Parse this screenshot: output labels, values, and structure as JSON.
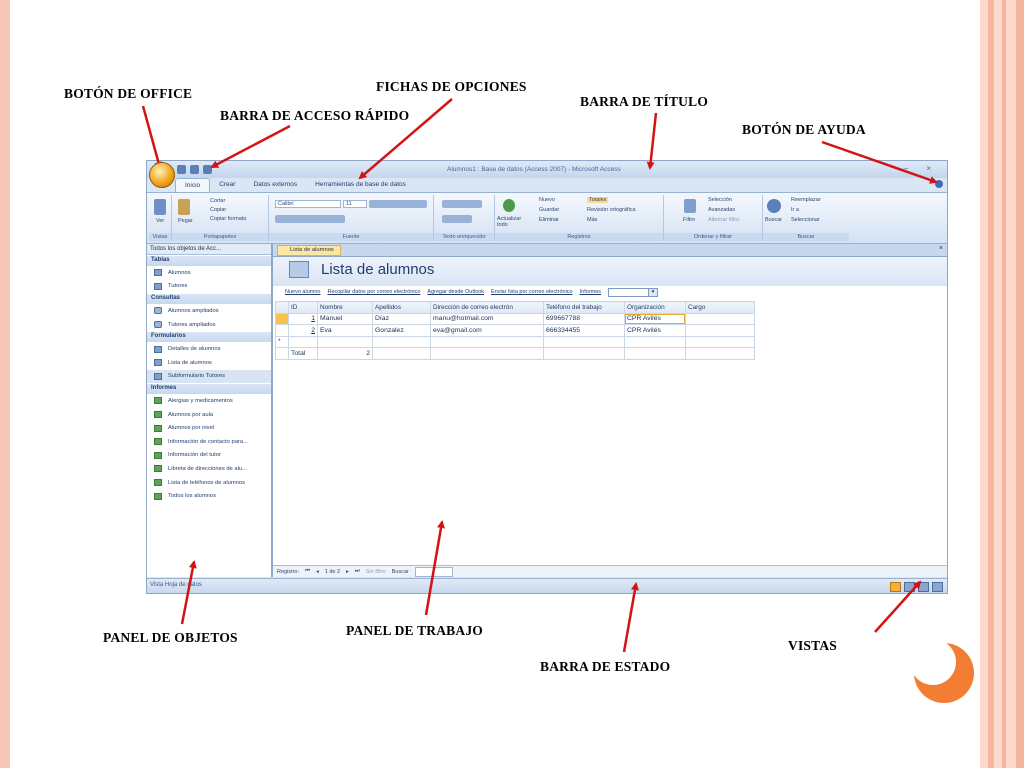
{
  "slide": {
    "colors": {
      "stripe_light": "#fbd9cb",
      "stripe_mid": "#f6b59d",
      "accent_circle": "#f47d34",
      "arrow": "#d21414"
    },
    "annotations": {
      "office_button": "BOTÓN DE OFFICE",
      "option_tabs": "FICHAS DE OPCIONES",
      "quick_access_bar": "BARRA DE ACCESO RÁPIDO",
      "title_bar": "BARRA DE TÍTULO",
      "help_button": "BOTÓN DE AYUDA",
      "objects_panel": "PANEL DE OBJETOS",
      "work_panel": "PANEL DE TRABAJO",
      "views": "VISTAS",
      "status_bar": "BARRA DE ESTADO"
    }
  },
  "app": {
    "window_title": "Alumnos1 : Base de datos (Access 2007) - Microsoft Access",
    "window_controls": "–  ×",
    "tabs": [
      "Inicio",
      "Crear",
      "Datos externos",
      "Herramientas de base de datos"
    ],
    "ribbon": {
      "groups": [
        "Vistas",
        "Portapapeles",
        "Fuente",
        "Texto enriquecido",
        "Registros",
        "Ordenar y filtrar",
        "Buscar"
      ],
      "view_label": "Ver",
      "paste_label": "Pegar",
      "clipboard_items": [
        "Cortar",
        "Copiar",
        "Copiar formato"
      ],
      "font_name": "Calibri",
      "font_size": "11",
      "refresh_label": "Actualizar todo",
      "records_items": [
        "Nuevo",
        "Guardar",
        "Eliminar",
        "Totales",
        "Revisión ortográfica",
        "Más"
      ],
      "filter_label": "Filtro",
      "sort_items": [
        "Selección",
        "Avanzadas",
        "Alternar filtro"
      ],
      "find_label": "Buscar",
      "find_items": [
        "Reemplazar",
        "Ir a",
        "Seleccionar"
      ]
    },
    "nav_pane": {
      "header": "Todos los objetos de Acc...",
      "groups": [
        {
          "name": "Tablas",
          "items": [
            "Alumnos",
            "Tutores"
          ]
        },
        {
          "name": "Consultas",
          "items": [
            "Alumnos ampliados",
            "Tutores ampliados"
          ]
        },
        {
          "name": "Formularios",
          "items": [
            "Detalles de alumnos",
            "Lista de alumnos",
            "Subformulario Tutores"
          ]
        },
        {
          "name": "Informes",
          "items": [
            "Alergias y medicamentos",
            "Alumnos por aula",
            "Alumnos por nivel",
            "Información de contacto para...",
            "Información del tutor",
            "Libreta de direcciones de alu...",
            "Lista de teléfonos de alumnos",
            "Todos los alumnos"
          ]
        }
      ]
    },
    "document_tab": "Lista de alumnos",
    "form_title": "Lista de alumnos",
    "form_actions": [
      "Nuevo alumno",
      "Recopilar datos por correo electrónico",
      "Agregar desde Outlook",
      "Enviar lista por correo electrónico",
      "Informes"
    ],
    "grid": {
      "columns": [
        "ID",
        "Nombre",
        "Apellidos",
        "Dirección de correo electrón",
        "Teléfono del trabajo",
        "Organización",
        "Cargo"
      ],
      "rows": [
        [
          "1",
          "Manuel",
          "Díaz",
          "manu@hotmail.com",
          "699667788",
          "CPR Avilés",
          ""
        ],
        [
          "2",
          "Eva",
          "Gonzalez",
          "eva@gmail.com",
          "666334455",
          "CPR Avilés",
          ""
        ]
      ],
      "new_row_marker": "*",
      "total_label": "Total",
      "total_value": "2"
    },
    "record_nav": {
      "label": "Registro:",
      "position": "1 de 2",
      "filter": "Sin filtro",
      "search": "Buscar"
    },
    "status_text": "Vista Hoja de datos"
  }
}
